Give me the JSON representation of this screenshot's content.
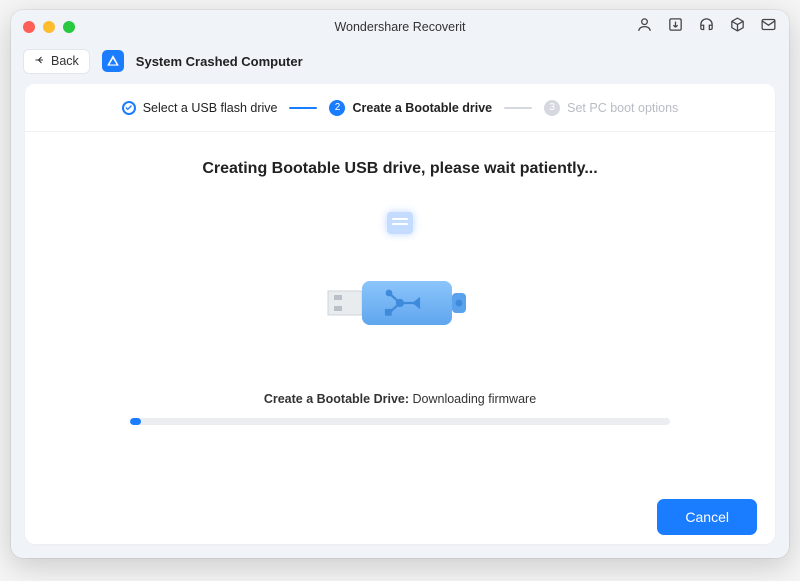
{
  "window": {
    "title": "Wondershare Recoverit"
  },
  "subheader": {
    "back_label": "Back",
    "module_title": "System Crashed Computer"
  },
  "steps": {
    "s1": {
      "label": "Select a USB flash drive"
    },
    "s2": {
      "label": "Create a Bootable drive",
      "num": "2"
    },
    "s3": {
      "label": "Set PC boot options",
      "num": "3"
    }
  },
  "main": {
    "heading": "Creating Bootable USB drive, please wait patiently...",
    "progress_label_bold": "Create a Bootable Drive:",
    "progress_status": " Downloading firmware",
    "progress_percent": 2
  },
  "footer": {
    "cancel_label": "Cancel"
  }
}
